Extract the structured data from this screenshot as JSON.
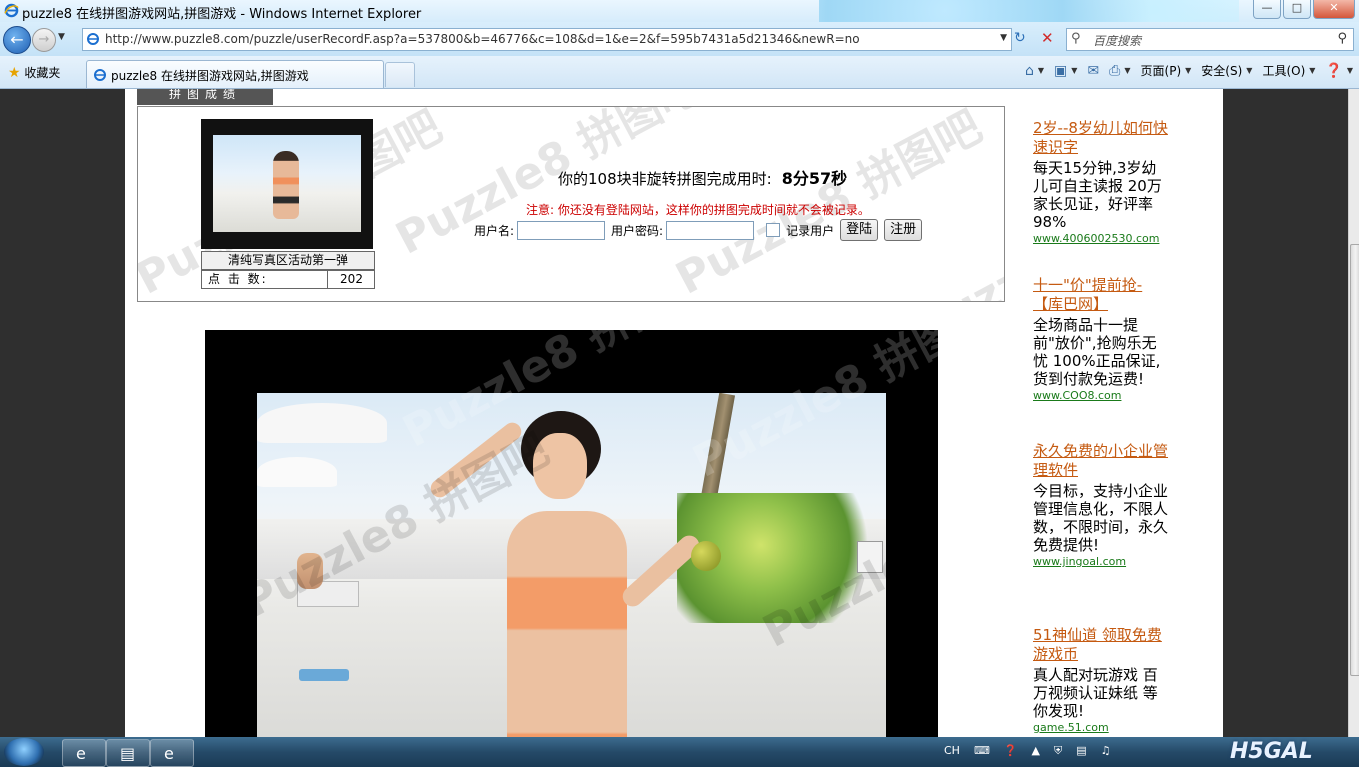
{
  "window": {
    "title": "puzzle8 在线拼图游戏网站,拼图游戏 - Windows Internet Explorer"
  },
  "address": {
    "url": "http://www.puzzle8.com/puzzle/userRecordF.asp?a=537800&b=46776&c=108&d=1&e=2&f=595b7431a5d21346&newR=no"
  },
  "search": {
    "placeholder": "百度搜索"
  },
  "favorites": {
    "label": "收藏夹"
  },
  "tab": {
    "title": "puzzle8 在线拼图游戏网站,拼图游戏"
  },
  "commands": {
    "page": "页面(P)",
    "safety": "安全(S)",
    "tools": "工具(O)"
  },
  "page": {
    "section_header": "拼图成绩",
    "thumb_caption": "清纯写真区活动第一弹",
    "clicks_label": "点 击 数:",
    "clicks_value": "202",
    "result_text": "你的108块非旋转拼图完成用时:",
    "result_time": "8分57秒",
    "notice": "注意: 你还没有登陆网站，这样你的拼图完成时间就不会被记录。",
    "login": {
      "username_label": "用户名:",
      "password_label": "用户密码:",
      "remember_label": "记录用户",
      "login_button": "登陆",
      "register_button": "注册"
    },
    "watermark": "Puzzle8 拼图吧"
  },
  "ads": [
    {
      "title": "2岁--8岁幼儿如何快速识字",
      "desc": "每天15分钟,3岁幼儿可自主读报 20万家长见证，好评率98%",
      "link": "www.4006002530.com"
    },
    {
      "title": "十一\"价\"提前抢-【库巴网】",
      "desc": "全场商品十一提前\"放价\",抢购乐无忧 100%正品保证,货到付款免运费!",
      "link": "www.COO8.com"
    },
    {
      "title": "永久免费的小企业管理软件",
      "desc": "今目标，支持小企业管理信息化，不限人数，不限时间，永久免费提供!",
      "link": "www.jingoal.com"
    },
    {
      "title": "51神仙道 领取免费游戏币",
      "desc": "真人配对玩游戏 百万视频认证妹纸 等你发现!",
      "link": "game.51.com"
    }
  ],
  "taskbar": {
    "lang": "CH",
    "logo": "H5GAL"
  }
}
